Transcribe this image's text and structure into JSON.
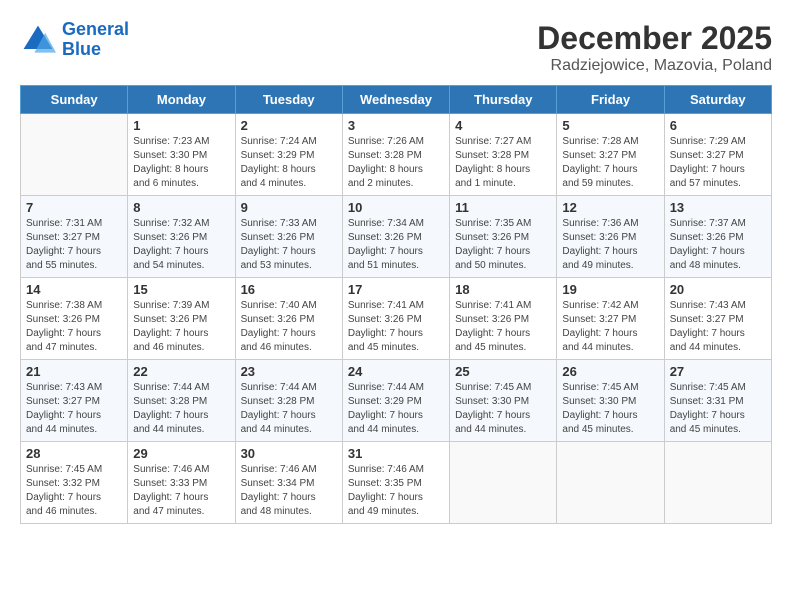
{
  "header": {
    "logo_line1": "General",
    "logo_line2": "Blue",
    "month": "December 2025",
    "location": "Radziejowice, Mazovia, Poland"
  },
  "weekdays": [
    "Sunday",
    "Monday",
    "Tuesday",
    "Wednesday",
    "Thursday",
    "Friday",
    "Saturday"
  ],
  "weeks": [
    [
      {
        "day": "",
        "info": ""
      },
      {
        "day": "1",
        "info": "Sunrise: 7:23 AM\nSunset: 3:30 PM\nDaylight: 8 hours\nand 6 minutes."
      },
      {
        "day": "2",
        "info": "Sunrise: 7:24 AM\nSunset: 3:29 PM\nDaylight: 8 hours\nand 4 minutes."
      },
      {
        "day": "3",
        "info": "Sunrise: 7:26 AM\nSunset: 3:28 PM\nDaylight: 8 hours\nand 2 minutes."
      },
      {
        "day": "4",
        "info": "Sunrise: 7:27 AM\nSunset: 3:28 PM\nDaylight: 8 hours\nand 1 minute."
      },
      {
        "day": "5",
        "info": "Sunrise: 7:28 AM\nSunset: 3:27 PM\nDaylight: 7 hours\nand 59 minutes."
      },
      {
        "day": "6",
        "info": "Sunrise: 7:29 AM\nSunset: 3:27 PM\nDaylight: 7 hours\nand 57 minutes."
      }
    ],
    [
      {
        "day": "7",
        "info": "Sunrise: 7:31 AM\nSunset: 3:27 PM\nDaylight: 7 hours\nand 55 minutes."
      },
      {
        "day": "8",
        "info": "Sunrise: 7:32 AM\nSunset: 3:26 PM\nDaylight: 7 hours\nand 54 minutes."
      },
      {
        "day": "9",
        "info": "Sunrise: 7:33 AM\nSunset: 3:26 PM\nDaylight: 7 hours\nand 53 minutes."
      },
      {
        "day": "10",
        "info": "Sunrise: 7:34 AM\nSunset: 3:26 PM\nDaylight: 7 hours\nand 51 minutes."
      },
      {
        "day": "11",
        "info": "Sunrise: 7:35 AM\nSunset: 3:26 PM\nDaylight: 7 hours\nand 50 minutes."
      },
      {
        "day": "12",
        "info": "Sunrise: 7:36 AM\nSunset: 3:26 PM\nDaylight: 7 hours\nand 49 minutes."
      },
      {
        "day": "13",
        "info": "Sunrise: 7:37 AM\nSunset: 3:26 PM\nDaylight: 7 hours\nand 48 minutes."
      }
    ],
    [
      {
        "day": "14",
        "info": "Sunrise: 7:38 AM\nSunset: 3:26 PM\nDaylight: 7 hours\nand 47 minutes."
      },
      {
        "day": "15",
        "info": "Sunrise: 7:39 AM\nSunset: 3:26 PM\nDaylight: 7 hours\nand 46 minutes."
      },
      {
        "day": "16",
        "info": "Sunrise: 7:40 AM\nSunset: 3:26 PM\nDaylight: 7 hours\nand 46 minutes."
      },
      {
        "day": "17",
        "info": "Sunrise: 7:41 AM\nSunset: 3:26 PM\nDaylight: 7 hours\nand 45 minutes."
      },
      {
        "day": "18",
        "info": "Sunrise: 7:41 AM\nSunset: 3:26 PM\nDaylight: 7 hours\nand 45 minutes."
      },
      {
        "day": "19",
        "info": "Sunrise: 7:42 AM\nSunset: 3:27 PM\nDaylight: 7 hours\nand 44 minutes."
      },
      {
        "day": "20",
        "info": "Sunrise: 7:43 AM\nSunset: 3:27 PM\nDaylight: 7 hours\nand 44 minutes."
      }
    ],
    [
      {
        "day": "21",
        "info": "Sunrise: 7:43 AM\nSunset: 3:27 PM\nDaylight: 7 hours\nand 44 minutes."
      },
      {
        "day": "22",
        "info": "Sunrise: 7:44 AM\nSunset: 3:28 PM\nDaylight: 7 hours\nand 44 minutes."
      },
      {
        "day": "23",
        "info": "Sunrise: 7:44 AM\nSunset: 3:28 PM\nDaylight: 7 hours\nand 44 minutes."
      },
      {
        "day": "24",
        "info": "Sunrise: 7:44 AM\nSunset: 3:29 PM\nDaylight: 7 hours\nand 44 minutes."
      },
      {
        "day": "25",
        "info": "Sunrise: 7:45 AM\nSunset: 3:30 PM\nDaylight: 7 hours\nand 44 minutes."
      },
      {
        "day": "26",
        "info": "Sunrise: 7:45 AM\nSunset: 3:30 PM\nDaylight: 7 hours\nand 45 minutes."
      },
      {
        "day": "27",
        "info": "Sunrise: 7:45 AM\nSunset: 3:31 PM\nDaylight: 7 hours\nand 45 minutes."
      }
    ],
    [
      {
        "day": "28",
        "info": "Sunrise: 7:45 AM\nSunset: 3:32 PM\nDaylight: 7 hours\nand 46 minutes."
      },
      {
        "day": "29",
        "info": "Sunrise: 7:46 AM\nSunset: 3:33 PM\nDaylight: 7 hours\nand 47 minutes."
      },
      {
        "day": "30",
        "info": "Sunrise: 7:46 AM\nSunset: 3:34 PM\nDaylight: 7 hours\nand 48 minutes."
      },
      {
        "day": "31",
        "info": "Sunrise: 7:46 AM\nSunset: 3:35 PM\nDaylight: 7 hours\nand 49 minutes."
      },
      {
        "day": "",
        "info": ""
      },
      {
        "day": "",
        "info": ""
      },
      {
        "day": "",
        "info": ""
      }
    ]
  ]
}
